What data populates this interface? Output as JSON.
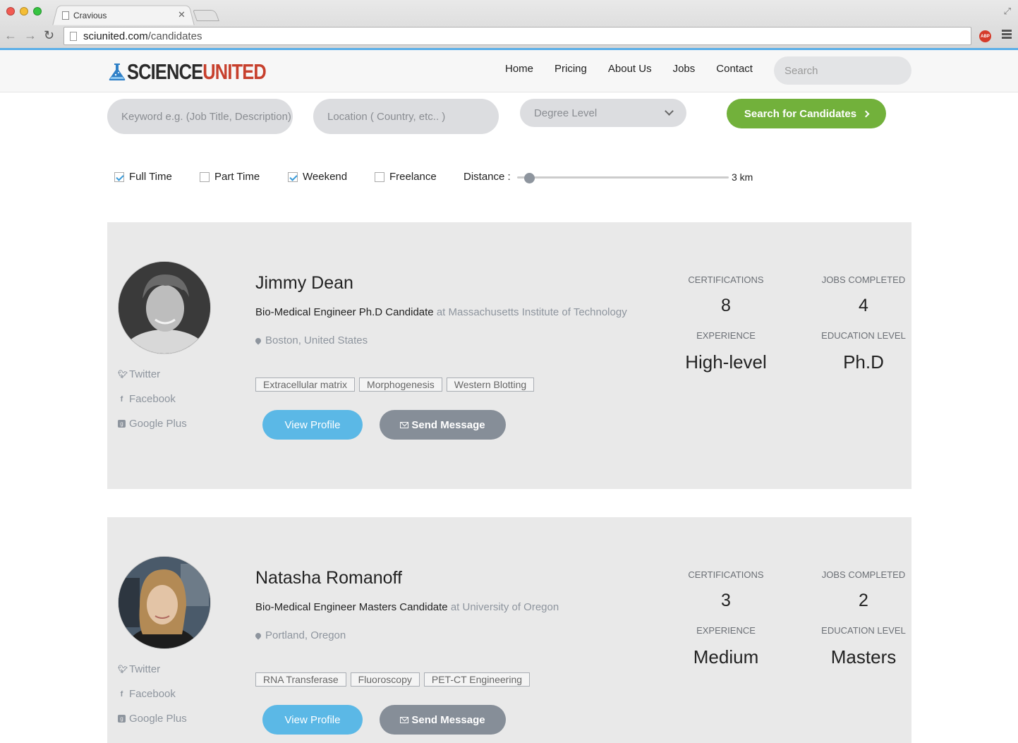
{
  "browser": {
    "tab_title": "Cravious",
    "url_domain": "sciunited.com",
    "url_path": "/candidates"
  },
  "site": {
    "logo_part1": "SCIENCE",
    "logo_part2": "UNITED",
    "nav": [
      "Home",
      "Pricing",
      "About Us",
      "Jobs",
      "Contact"
    ],
    "search_placeholder": "Search"
  },
  "filters": {
    "keyword_placeholder": "Keyword e.g. (Job Title, Description)",
    "location_placeholder": "Location ( Country, etc.. )",
    "degree_label": "Degree Level",
    "search_button": "Search for Candidates",
    "checkboxes": [
      {
        "label": "Full Time",
        "checked": true
      },
      {
        "label": "Part Time",
        "checked": false
      },
      {
        "label": "Weekend",
        "checked": true
      },
      {
        "label": "Freelance",
        "checked": false
      }
    ],
    "distance_label": "Distance :",
    "distance_value": "3 km"
  },
  "stat_labels": {
    "certifications": "CERTIFICATIONS",
    "jobs_completed": "JOBS COMPLETED",
    "experience": "EXPERIENCE",
    "education_level": "EDUCATION LEVEL"
  },
  "social_labels": {
    "twitter": "Twitter",
    "facebook": "Facebook",
    "google_plus": "Google Plus"
  },
  "button_labels": {
    "view_profile": "View Profile",
    "send_message": "Send Message"
  },
  "candidates": [
    {
      "name": "Jimmy Dean",
      "title": "Bio-Medical Engineer Ph.D Candidate",
      "institution": "at Massachusetts Institute of Technology",
      "location": "Boston, United States",
      "tags": [
        "Extracellular matrix",
        "Morphogenesis",
        "Western Blotting"
      ],
      "certifications": "8",
      "jobs_completed": "4",
      "experience": "High-level",
      "education_level": "Ph.D"
    },
    {
      "name": "Natasha Romanoff",
      "title": "Bio-Medical Engineer Masters Candidate",
      "institution": "at University of Oregon",
      "location": "Portland, Oregon",
      "tags": [
        "RNA Transferase",
        "Fluoroscopy",
        "PET-CT Engineering"
      ],
      "certifications": "3",
      "jobs_completed": "2",
      "experience": "Medium",
      "education_level": "Masters"
    }
  ],
  "colors": {
    "accent_blue": "#5bb8e6",
    "accent_green": "#72b13b",
    "logo_red": "#c7402d",
    "gray_button": "#868e98"
  }
}
